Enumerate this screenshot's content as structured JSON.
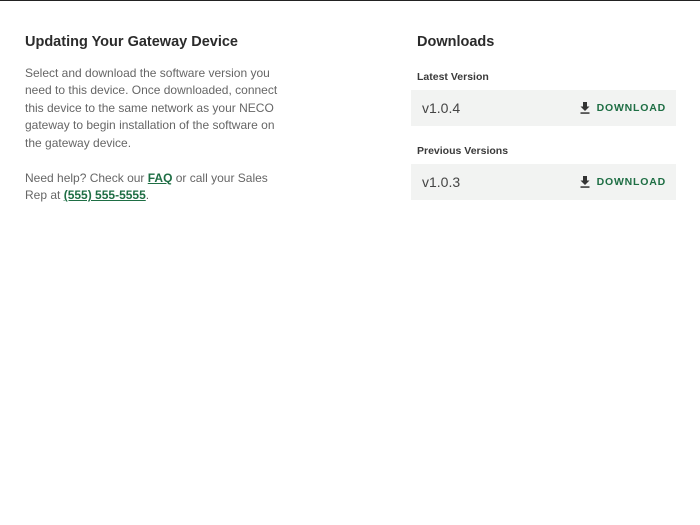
{
  "left": {
    "title": "Updating Your Gateway Device",
    "description": "Select and download the software version you need to this device. Once downloaded, connect this device to the same network as your NECO gateway to begin installation of the software on the gateway device.",
    "help_prefix": "Need help? Check our ",
    "faq_label": "FAQ",
    "help_middle": " or call your Sales Rep at ",
    "phone": "(555) 555-5555",
    "help_suffix": "."
  },
  "downloads": {
    "title": "Downloads",
    "latest": {
      "label": "Latest Version",
      "version": "v1.0.4",
      "button": "DOWNLOAD"
    },
    "previous": {
      "label": "Previous Versions",
      "items": [
        {
          "version": "v1.0.3",
          "button": "DOWNLOAD"
        }
      ]
    }
  },
  "icons": {
    "download": "download-icon"
  },
  "colors": {
    "accent": "#1e6e44",
    "row_background": "#f2f3f2",
    "body_text": "#666666"
  }
}
